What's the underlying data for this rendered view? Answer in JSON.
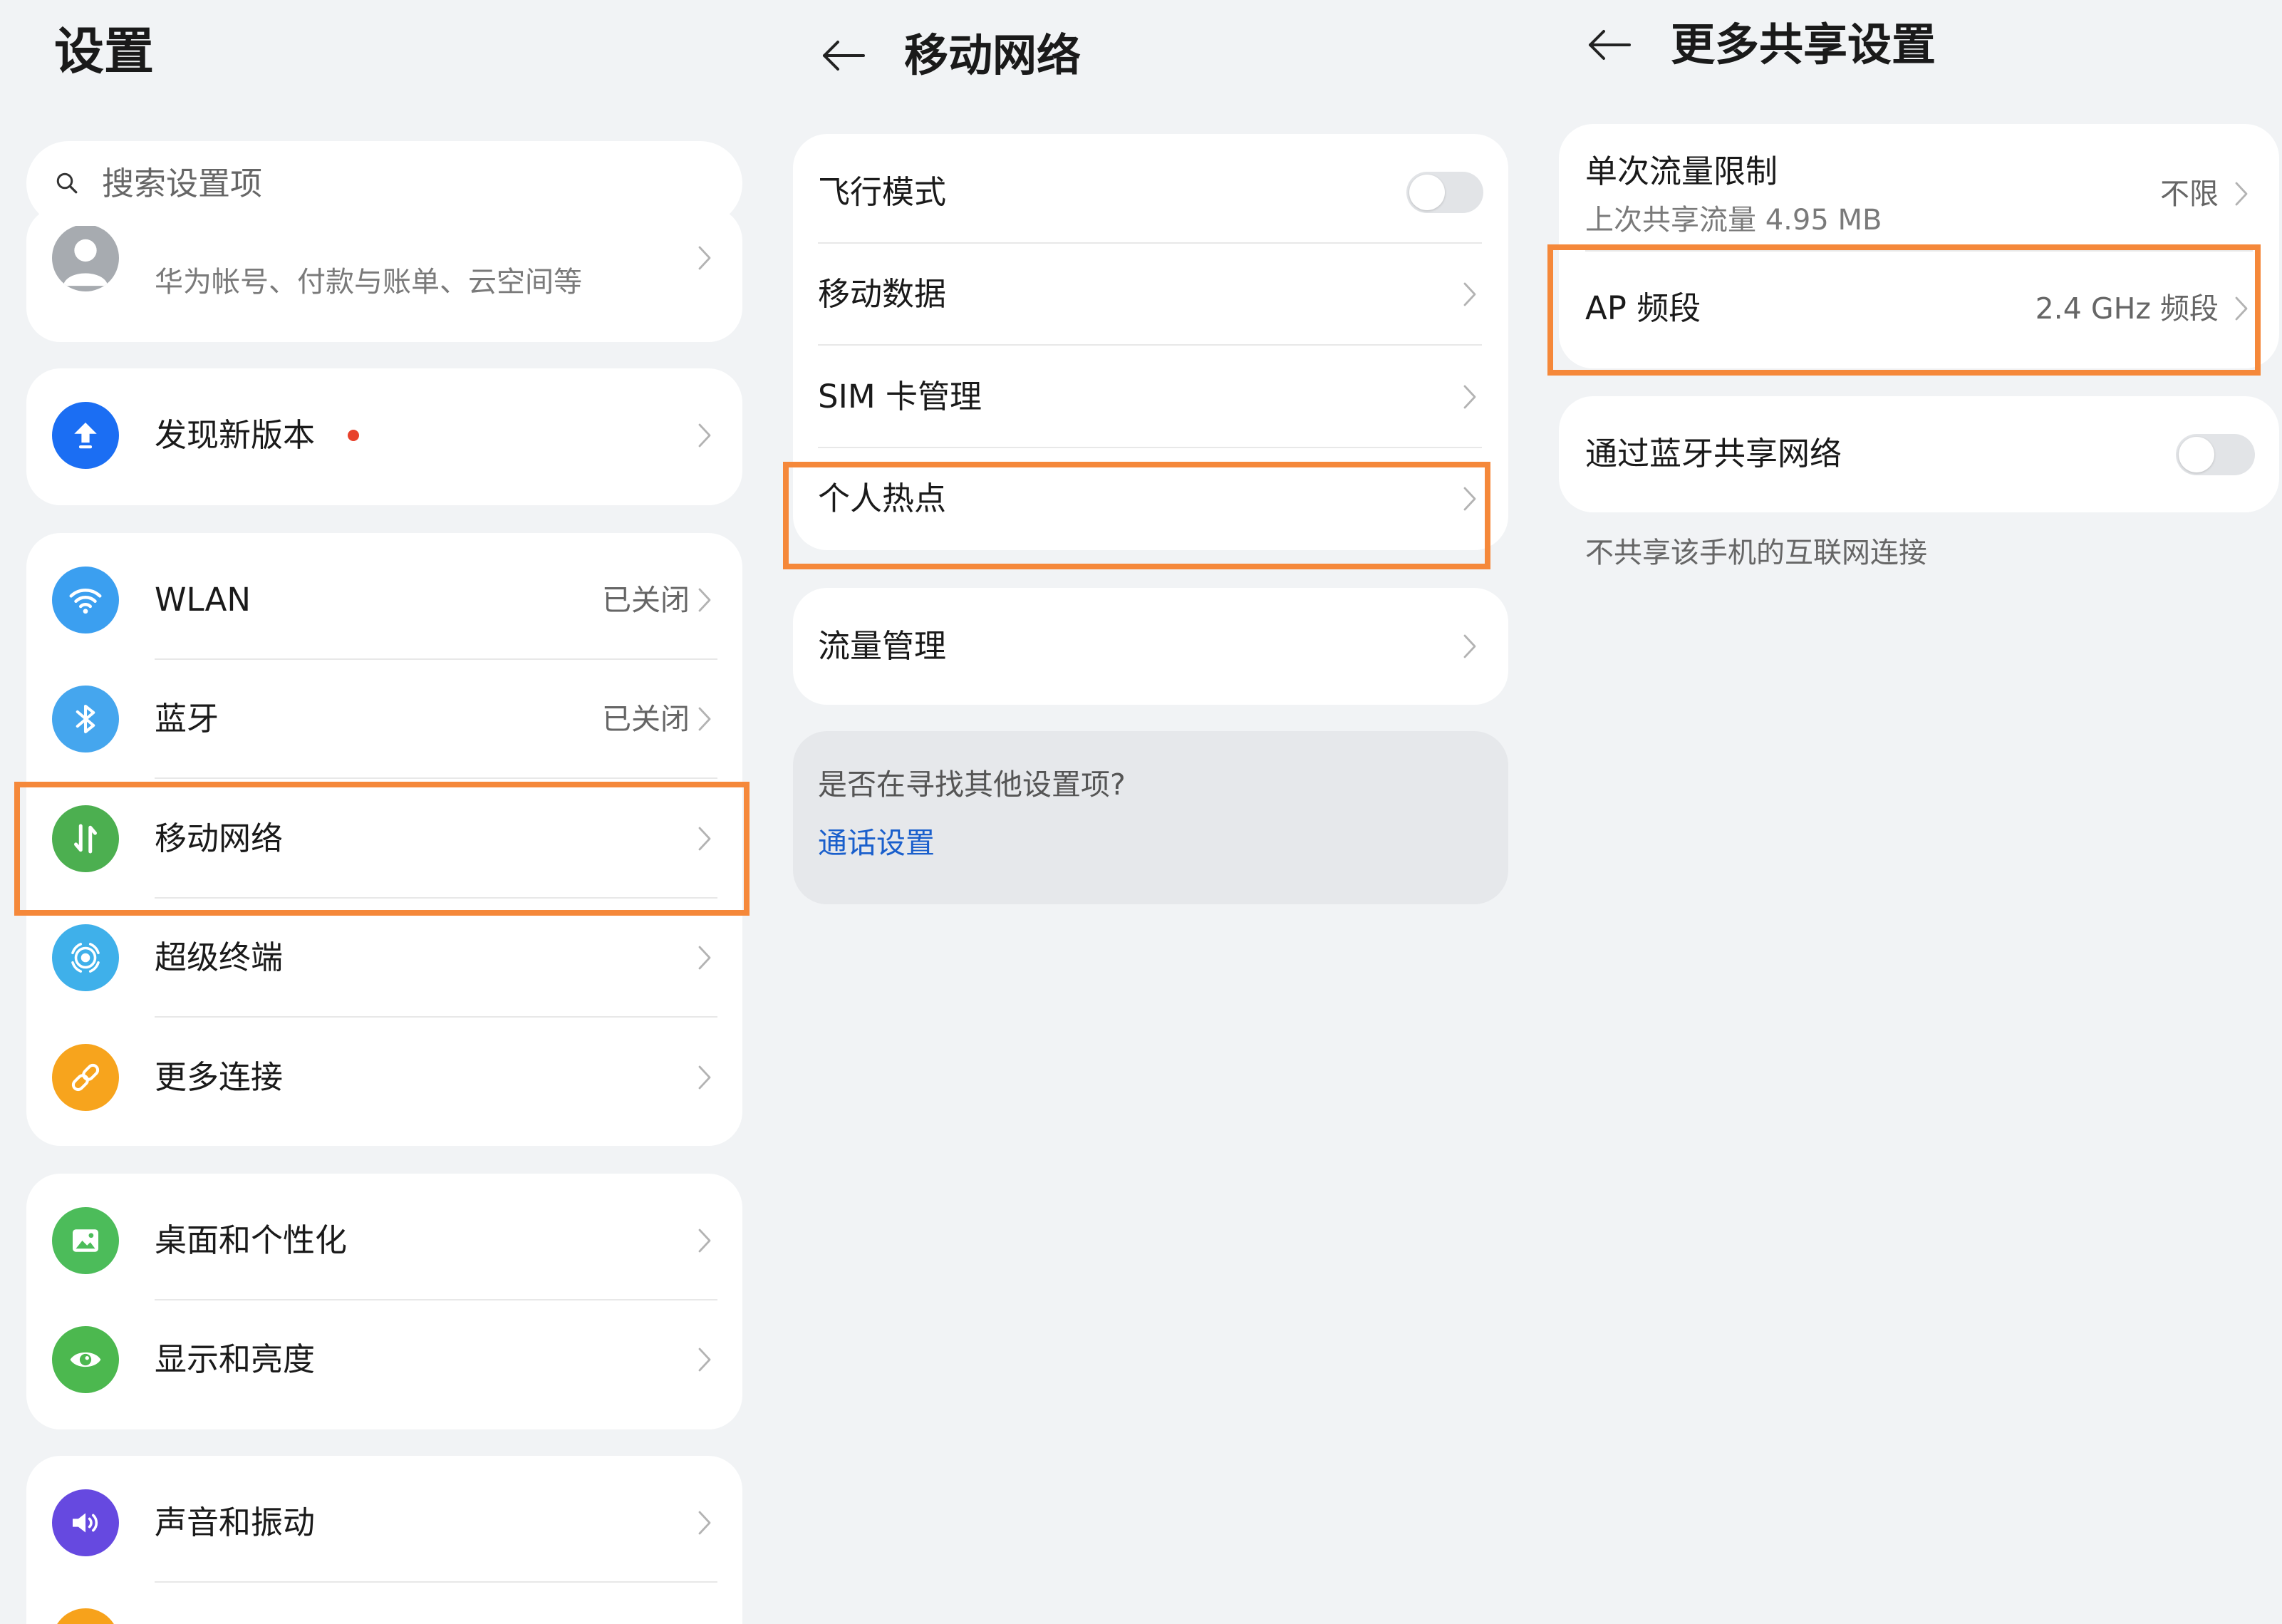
{
  "left": {
    "title": "设置",
    "search": {
      "placeholder": "搜索设置项"
    },
    "account": {
      "subtitle": "华为帐号、付款与账单、云空间等"
    },
    "update": {
      "label": "发现新版本"
    },
    "connectivity": [
      {
        "label": "WLAN",
        "value": "已关闭",
        "icon": "wifi-icon"
      },
      {
        "label": "蓝牙",
        "value": "已关闭",
        "icon": "bluetooth-icon"
      },
      {
        "label": "移动网络",
        "icon": "mobile-data-icon"
      },
      {
        "label": "超级终端",
        "icon": "super-device-icon"
      },
      {
        "label": "更多连接",
        "icon": "link-icon"
      }
    ],
    "display": [
      {
        "label": "桌面和个性化",
        "icon": "wallpaper-icon"
      },
      {
        "label": "显示和亮度",
        "icon": "eye-icon"
      }
    ],
    "sound": [
      {
        "label": "声音和振动",
        "icon": "speaker-icon"
      }
    ]
  },
  "middle": {
    "title": "移动网络",
    "items": [
      {
        "label": "飞行模式",
        "toggle_on": false
      },
      {
        "label": "移动数据"
      },
      {
        "label": "SIM 卡管理"
      },
      {
        "label": "个人热点"
      }
    ],
    "data_usage": {
      "label": "流量管理"
    },
    "suggest": {
      "question": "是否在寻找其他设置项?",
      "link": "通话设置"
    }
  },
  "right": {
    "title": "更多共享设置",
    "limit": {
      "label": "单次流量限制",
      "subtitle": "上次共享流量 4.95 MB",
      "value": "不限"
    },
    "ap_band": {
      "label": "AP 频段",
      "value": "2.4 GHz 频段"
    },
    "bluetooth_tether": {
      "label": "通过蓝牙共享网络",
      "toggle_on": false
    },
    "note": "不共享该手机的互联网连接"
  },
  "colors": {
    "background": "#f1f3f5",
    "card": "#ffffff",
    "highlight": "#f5883a",
    "link": "#1a5fcc",
    "notification_dot": "#e8412c"
  }
}
